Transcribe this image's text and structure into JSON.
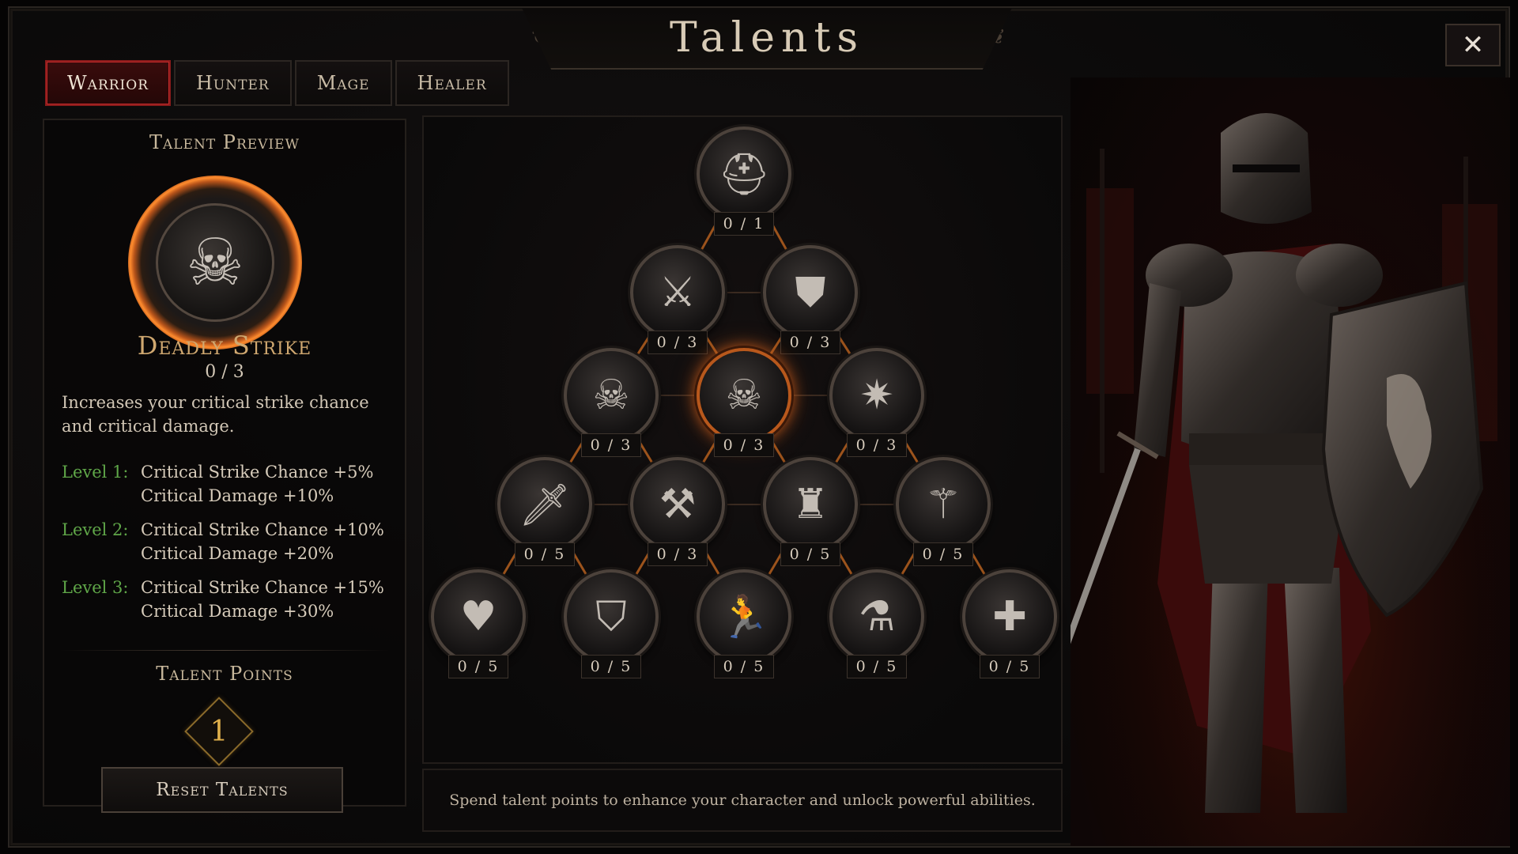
{
  "title": "Talents",
  "close_symbol": "✕",
  "tabs": [
    {
      "label": "Warrior",
      "active": true
    },
    {
      "label": "Hunter",
      "active": false
    },
    {
      "label": "Mage",
      "active": false
    },
    {
      "label": "Healer",
      "active": false
    }
  ],
  "preview": {
    "heading": "Talent Preview",
    "icon": "skull-helm-icon",
    "name": "Deadly Strike",
    "rank": "0 / 3",
    "description": "Increases your critical strike chance and critical damage.",
    "levels": [
      {
        "label": "Level 1:",
        "effects": [
          "Critical Strike Chance +5%",
          "Critical Damage +10%"
        ]
      },
      {
        "label": "Level 2:",
        "effects": [
          "Critical Strike Chance +10%",
          "Critical Damage +20%"
        ]
      },
      {
        "label": "Level 3:",
        "effects": [
          "Critical Strike Chance +15%",
          "Critical Damage +30%"
        ]
      }
    ]
  },
  "points": {
    "heading": "Talent Points",
    "value": "1"
  },
  "reset_label": "Reset Talents",
  "hint": "Spend talent points to enhance your character and unlock powerful abilities.",
  "tree": {
    "rows": [
      [
        {
          "icon": "spartan-helmet-icon",
          "glyph": "⛑",
          "rank": "0 / 1"
        }
      ],
      [
        {
          "icon": "crossed-swords-icon",
          "glyph": "⚔",
          "rank": "0 / 3"
        },
        {
          "icon": "shield-icon",
          "glyph": "⛊",
          "rank": "0 / 3"
        }
      ],
      [
        {
          "icon": "horned-skull-icon",
          "glyph": "☠",
          "rank": "0 / 3"
        },
        {
          "icon": "skull-icon",
          "glyph": "☠",
          "rank": "0 / 3",
          "selected": true
        },
        {
          "icon": "sword-burst-icon",
          "glyph": "✷",
          "rank": "0 / 3"
        }
      ],
      [
        {
          "icon": "sword-icon",
          "glyph": "🗡",
          "rank": "0 / 5"
        },
        {
          "icon": "crossed-axes-icon",
          "glyph": "⚒",
          "rank": "0 / 3"
        },
        {
          "icon": "armor-icon",
          "glyph": "♜",
          "rank": "0 / 5"
        },
        {
          "icon": "mace-icon",
          "glyph": "⚚",
          "rank": "0 / 5"
        }
      ],
      [
        {
          "icon": "heart-icon",
          "glyph": "♥",
          "rank": "0 / 5"
        },
        {
          "icon": "shield-small-icon",
          "glyph": "⛉",
          "rank": "0 / 5"
        },
        {
          "icon": "running-man-icon",
          "glyph": "🏃",
          "rank": "0 / 5"
        },
        {
          "icon": "potions-icon",
          "glyph": "⚗",
          "rank": "0 / 5"
        },
        {
          "icon": "cross-icon",
          "glyph": "✚",
          "rank": "0 / 5"
        }
      ]
    ]
  },
  "colors": {
    "accent_red": "#8a1b1b",
    "selected_glow": "#c55a1a",
    "level_green": "#5fa648",
    "gold": "#e0b04c"
  }
}
